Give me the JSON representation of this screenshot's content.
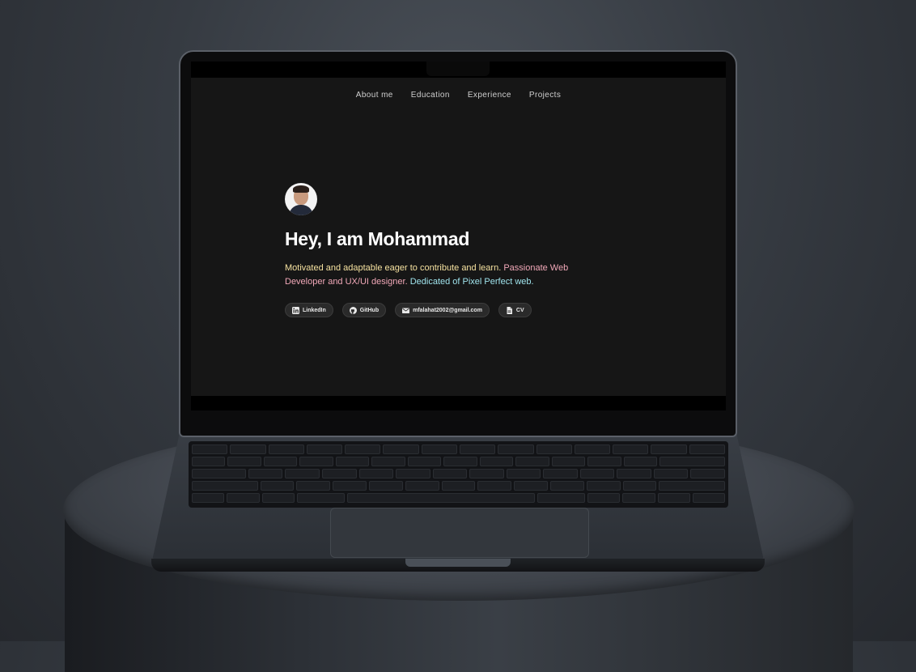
{
  "nav": {
    "items": [
      "About me",
      "Education",
      "Experience",
      "Projects"
    ]
  },
  "hero": {
    "title": "Hey, I am Mohammad",
    "desc_part1": "Motivated and adaptable eager to contribute and learn. ",
    "desc_part2": "Passionate Web Developer and UX/UI designer. ",
    "desc_part3": "Dedicated of Pixel Perfect web."
  },
  "badges": [
    {
      "label": "LinkedIn",
      "icon": "linkedin-icon"
    },
    {
      "label": "GitHub",
      "icon": "github-icon"
    },
    {
      "label": "mfalahat2002@gmail.com",
      "icon": "mail-icon"
    },
    {
      "label": "CV",
      "icon": "document-icon"
    }
  ],
  "colors": {
    "background": "#161616",
    "title": "#ffffff",
    "desc_yellow": "#f6e2a0",
    "desc_pink": "#f1a8b8",
    "desc_cyan": "#9fe3ec"
  }
}
